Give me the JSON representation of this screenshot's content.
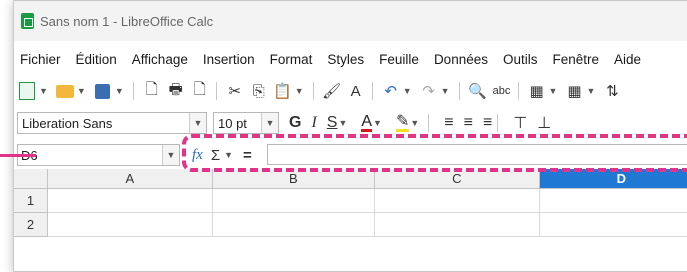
{
  "window": {
    "title": "Sans nom 1 - LibreOffice Calc"
  },
  "menubar": {
    "items": [
      "Fichier",
      "Édition",
      "Affichage",
      "Insertion",
      "Format",
      "Styles",
      "Feuille",
      "Données",
      "Outils",
      "Fenêtre",
      "Aide"
    ]
  },
  "toolbar": {
    "icons": [
      "new-spreadsheet-icon",
      "open-folder-icon",
      "save-icon",
      "export-pdf-icon",
      "print-icon",
      "print-preview-icon",
      "cut-icon",
      "copy-icon",
      "paste-icon",
      "clone-formatting-icon",
      "clear-formatting-icon",
      "undo-icon",
      "redo-icon",
      "find-replace-icon",
      "spelling-icon",
      "row-icon",
      "column-icon",
      "sort-icon"
    ]
  },
  "formatting": {
    "font_name": "Liberation Sans",
    "font_size": "10 pt",
    "bold": "G",
    "italic": "I",
    "underline": "S",
    "font_color_letter": "A",
    "font_color": "#d11c1c",
    "highlight_color": "#f3e020"
  },
  "formula_bar": {
    "name_box": "D6",
    "fx_label": "fx",
    "sum_label": "Σ",
    "equals_label": "=",
    "formula": ""
  },
  "grid": {
    "columns": [
      "A",
      "B",
      "C",
      "D"
    ],
    "active_column": "D",
    "rows": [
      "1",
      "2"
    ]
  },
  "annotation": {
    "highlight_color": "#e0348a"
  }
}
